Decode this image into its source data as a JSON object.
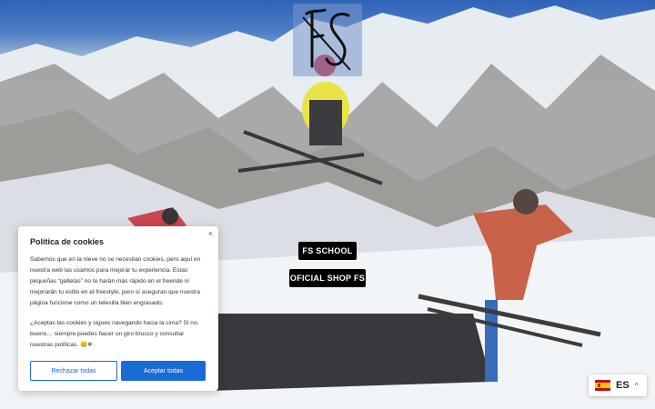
{
  "logo": {
    "text": "FS",
    "icon": "fs-logo"
  },
  "buttons": {
    "school": "FS SCHOOL",
    "shop": "OFICIAL SHOP FS"
  },
  "cookie": {
    "title": "Política de cookies",
    "paragraph1": "Sabemos que en la nieve no se necesitan cookies, pero aquí en nuestra web las usamos para mejorar tu experiencia. Estas pequeñas “galletas” no te harán más rápido en el freeride ni mejorarán tu estilo en el freestyle, pero sí aseguran que nuestra página funcione como un telesilla bien engrasado.",
    "paragraph2": "¿Aceptas las cookies y sigues navegando hacia la cima? Si no, bueno… siempre puedes hacer un giro brusco y consultar nuestras políticas. 😊❄",
    "close": "×",
    "reject_label": "Rechazar todas",
    "accept_label": "Aceptar todas",
    "accent": "#1a6ad8"
  },
  "language": {
    "code": "ES",
    "flag": "spain-flag-icon",
    "chevron": "^"
  }
}
